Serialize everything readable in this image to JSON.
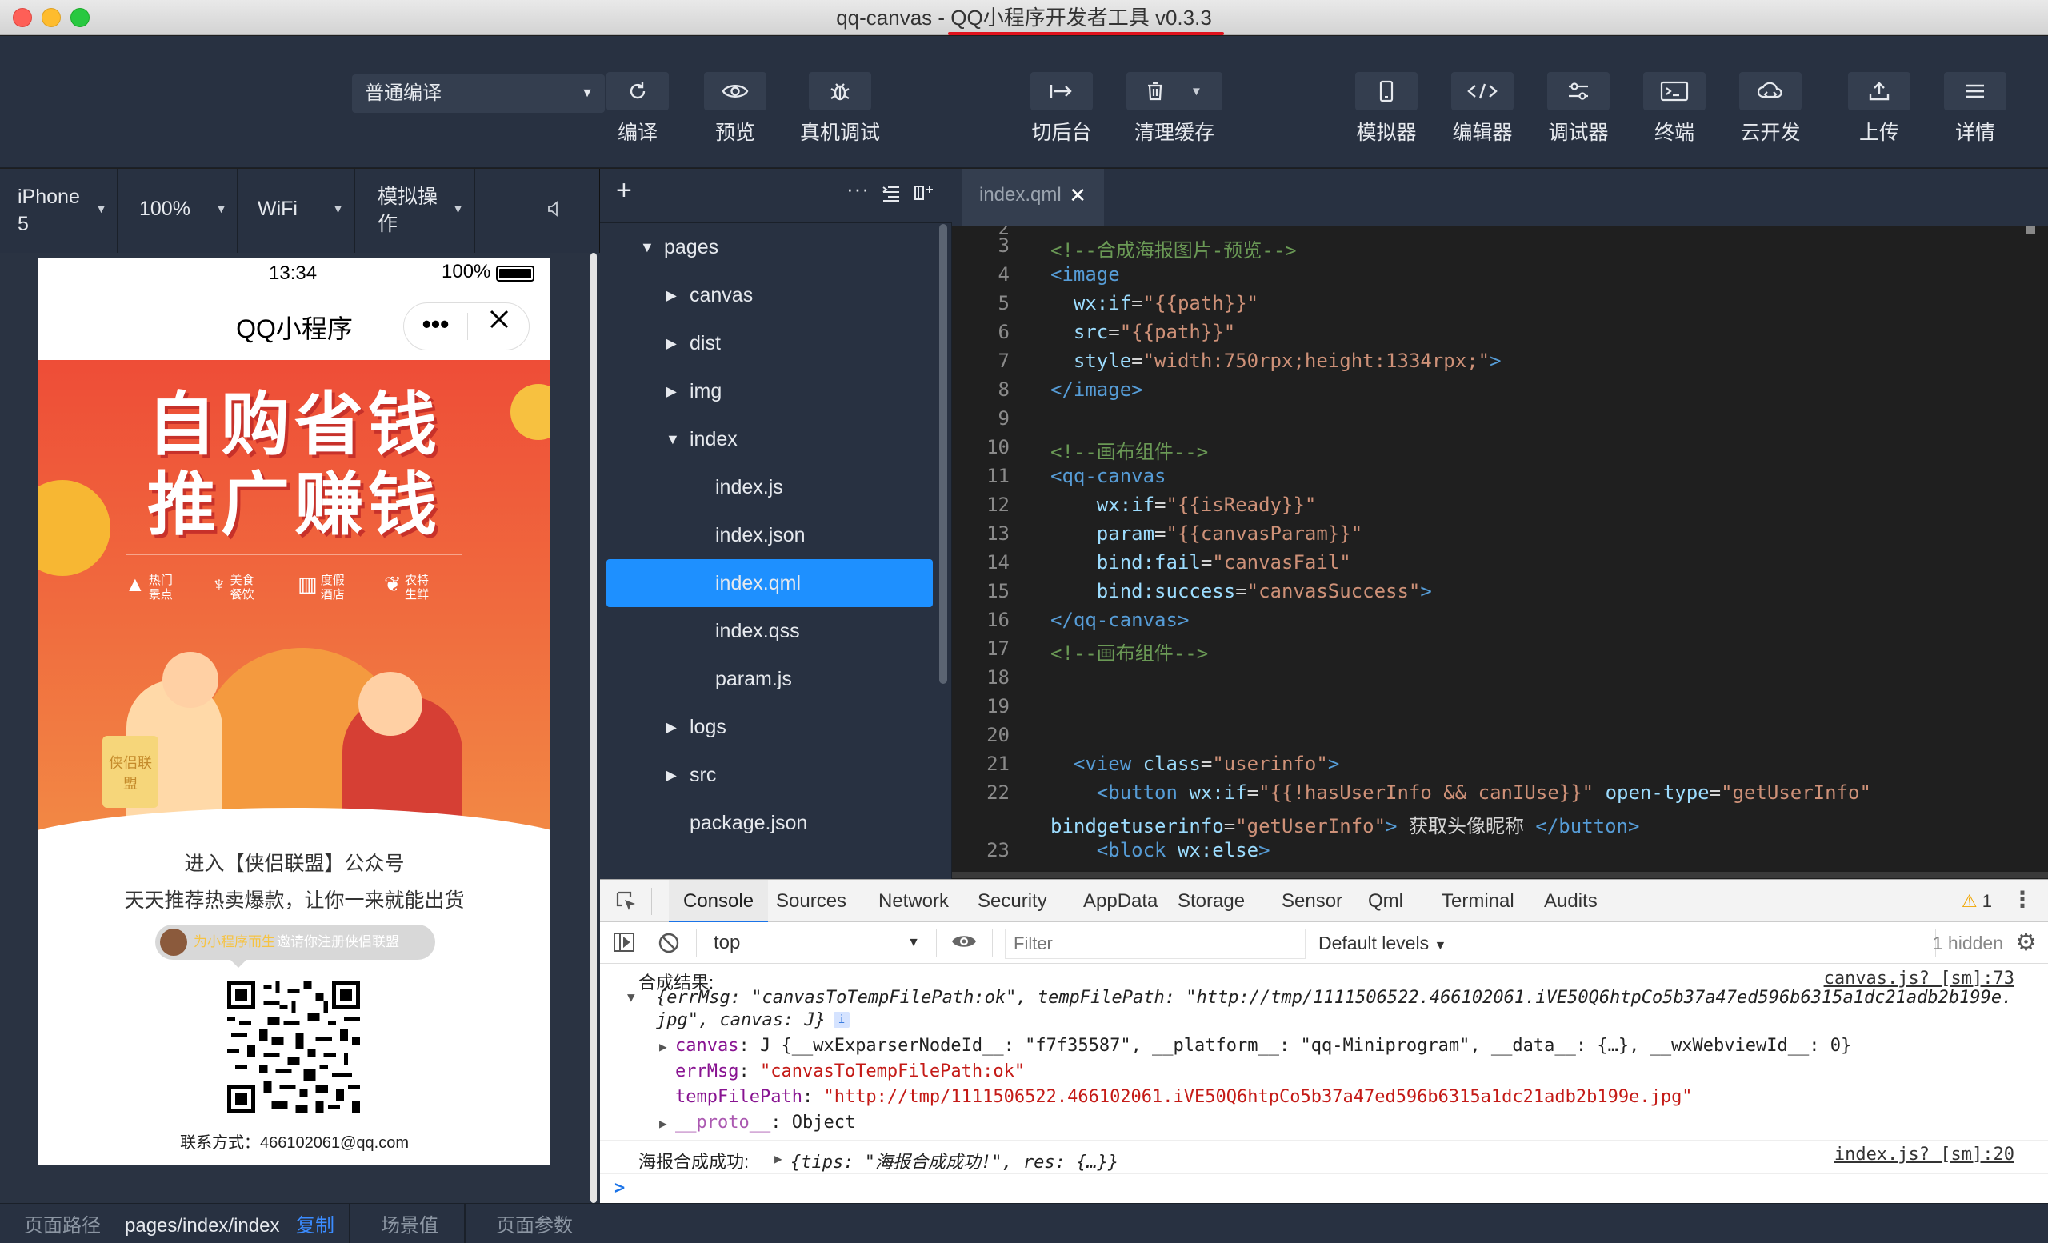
{
  "window": {
    "title_prefix": "qq-canvas - ",
    "title_app": "QQ小程序开发者工具 v0.3.3"
  },
  "toolbar": {
    "compile_mode": "普通编译",
    "left_buttons": [
      "编译",
      "预览",
      "真机调试"
    ],
    "mid_buttons": [
      "切后台",
      "清理缓存"
    ],
    "right_buttons": [
      "模拟器",
      "编辑器",
      "调试器",
      "终端",
      "云开发",
      "上传",
      "详情"
    ],
    "icons": [
      "refresh-icon",
      "eye-icon",
      "bug-icon",
      "switch-background-icon",
      "trash-icon",
      "phone-icon",
      "code-icon",
      "sliders-icon",
      "terminal-icon",
      "cloud-icon",
      "upload-icon",
      "menu-icon"
    ]
  },
  "device_bar": {
    "device": "iPhone 5",
    "zoom": "100%",
    "network": "WiFi",
    "operation": "模拟操作"
  },
  "phone": {
    "time": "13:34",
    "battery": "100%",
    "nav_title": "QQ小程序",
    "poster": {
      "headline_line1": "自购省钱",
      "headline_line2": "推广赚钱",
      "categories": [
        "热门景点",
        "美食餐饮",
        "度假酒店",
        "农特生鲜"
      ],
      "bag_text": "侠侣联盟",
      "line1": "进入【侠侣联盟】公众号",
      "line2": "天天推荐热卖爆款，让你一来就能出货",
      "invite_name": "为小程序而生",
      "invite_text": "邀请你注册侠侣联盟",
      "contact": "联系方式：466102061@qq.com"
    }
  },
  "file_tree": {
    "items": [
      {
        "label": "pages",
        "type": "folder",
        "open": true,
        "depth": 0
      },
      {
        "label": "canvas",
        "type": "folder",
        "open": false,
        "depth": 1
      },
      {
        "label": "dist",
        "type": "folder",
        "open": false,
        "depth": 1
      },
      {
        "label": "img",
        "type": "folder",
        "open": false,
        "depth": 1
      },
      {
        "label": "index",
        "type": "folder",
        "open": true,
        "depth": 1
      },
      {
        "label": "index.js",
        "type": "file",
        "depth": 2
      },
      {
        "label": "index.json",
        "type": "file",
        "depth": 2
      },
      {
        "label": "index.qml",
        "type": "file",
        "depth": 2,
        "selected": true
      },
      {
        "label": "index.qss",
        "type": "file",
        "depth": 2
      },
      {
        "label": "param.js",
        "type": "file",
        "depth": 2
      },
      {
        "label": "logs",
        "type": "folder",
        "open": false,
        "depth": 1
      },
      {
        "label": "src",
        "type": "folder",
        "open": false,
        "depth": 1
      },
      {
        "label": "package.json",
        "type": "file",
        "depth": 1
      }
    ]
  },
  "editor": {
    "tab": "index.qml",
    "partial_top_line": "2",
    "lines": [
      {
        "n": "3",
        "p": [
          [
            "cm",
            "<!--合成海报图片-预览-->"
          ]
        ]
      },
      {
        "n": "4",
        "p": [
          [
            "tg",
            "<image"
          ]
        ]
      },
      {
        "n": "5",
        "p": [
          [
            "pl",
            "  "
          ],
          [
            "at",
            "wx:if"
          ],
          [
            "pl",
            "="
          ],
          [
            "sv",
            "\"{{path}}\""
          ]
        ]
      },
      {
        "n": "6",
        "p": [
          [
            "pl",
            "  "
          ],
          [
            "at",
            "src"
          ],
          [
            "pl",
            "="
          ],
          [
            "sv",
            "\"{{path}}\""
          ]
        ]
      },
      {
        "n": "7",
        "p": [
          [
            "pl",
            "  "
          ],
          [
            "at",
            "style"
          ],
          [
            "pl",
            "="
          ],
          [
            "sv",
            "\"width:750rpx;height:1334rpx;\""
          ],
          [
            "tg",
            ">"
          ]
        ]
      },
      {
        "n": "8",
        "p": [
          [
            "tg",
            "</image>"
          ]
        ]
      },
      {
        "n": "9",
        "p": []
      },
      {
        "n": "10",
        "p": [
          [
            "cm",
            "<!--画布组件-->"
          ]
        ]
      },
      {
        "n": "11",
        "p": [
          [
            "tg",
            "<qq-canvas"
          ]
        ]
      },
      {
        "n": "12",
        "p": [
          [
            "pl",
            "    "
          ],
          [
            "at",
            "wx:if"
          ],
          [
            "pl",
            "="
          ],
          [
            "sv",
            "\"{{isReady}}\""
          ]
        ]
      },
      {
        "n": "13",
        "p": [
          [
            "pl",
            "    "
          ],
          [
            "at",
            "param"
          ],
          [
            "pl",
            "="
          ],
          [
            "sv",
            "\"{{canvasParam}}\""
          ]
        ]
      },
      {
        "n": "14",
        "p": [
          [
            "pl",
            "    "
          ],
          [
            "at",
            "bind:fail"
          ],
          [
            "pl",
            "="
          ],
          [
            "sv",
            "\"canvasFail\""
          ]
        ]
      },
      {
        "n": "15",
        "p": [
          [
            "pl",
            "    "
          ],
          [
            "at",
            "bind:success"
          ],
          [
            "pl",
            "="
          ],
          [
            "sv",
            "\"canvasSuccess\""
          ],
          [
            "tg",
            ">"
          ]
        ]
      },
      {
        "n": "16",
        "p": [
          [
            "tg",
            "</qq-canvas>"
          ]
        ]
      },
      {
        "n": "17",
        "p": [
          [
            "cm",
            "<!--画布组件-->"
          ]
        ]
      },
      {
        "n": "18",
        "p": []
      },
      {
        "n": "19",
        "p": []
      },
      {
        "n": "20",
        "p": []
      },
      {
        "n": "21",
        "p": [
          [
            "pl",
            "  "
          ],
          [
            "tg",
            "<view "
          ],
          [
            "at",
            "class"
          ],
          [
            "pl",
            "="
          ],
          [
            "sv",
            "\"userinfo\""
          ],
          [
            "tg",
            ">"
          ]
        ]
      },
      {
        "n": "22",
        "p": [
          [
            "pl",
            "    "
          ],
          [
            "tg",
            "<button "
          ],
          [
            "at",
            "wx:if"
          ],
          [
            "pl",
            "="
          ],
          [
            "sv",
            "\"{{!hasUserInfo && canIUse}}\""
          ],
          [
            "pl",
            " "
          ],
          [
            "at",
            "open-type"
          ],
          [
            "pl",
            "="
          ],
          [
            "sv",
            "\"getUserInfo\""
          ]
        ]
      },
      {
        "n": "",
        "p": [
          [
            "at",
            "bindgetuserinfo"
          ],
          [
            "pl",
            "="
          ],
          [
            "sv",
            "\"getUserInfo\""
          ],
          [
            "tg",
            ">"
          ],
          [
            "pl",
            " 获取头像昵称 "
          ],
          [
            "tg",
            "</button>"
          ]
        ]
      },
      {
        "n": "23",
        "p": [
          [
            "pl",
            "    "
          ],
          [
            "tg",
            "<block "
          ],
          [
            "at",
            "wx:else"
          ],
          [
            "tg",
            ">"
          ]
        ]
      }
    ]
  },
  "devtools": {
    "tabs": [
      "Console",
      "Sources",
      "Network",
      "Security",
      "AppData",
      "Storage",
      "Sensor",
      "Qml",
      "Terminal",
      "Audits"
    ],
    "active_tab": "Console",
    "warning_count": "1",
    "context": "top",
    "filter_placeholder": "Filter",
    "levels": "Default levels",
    "hidden": "1 hidden",
    "log1": {
      "label": "合成结果:",
      "source": "canvas.js? [sm]:73",
      "obj_line1": "{errMsg: \"canvasToTempFilePath:ok\", tempFilePath: \"http://tmp/1111506522.466102061.iVE50Q6htpCo5b37a47ed596b6315a1dc21adb2b199e.",
      "obj_line2": "jpg\", canvas: J}",
      "canvas_key": "canvas",
      "canvas_val": "J {__wxExparserNodeId__: \"f7f35587\", __platform__: \"qq-Miniprogram\", __data__: {…}, __wxWebviewId__: 0}",
      "errMsg_key": "errMsg",
      "errMsg_val": "\"canvasToTempFilePath:ok\"",
      "path_key": "tempFilePath",
      "path_val": "\"http://tmp/1111506522.466102061.iVE50Q6htpCo5b37a47ed596b6315a1dc21adb2b199e.jpg\"",
      "proto_key": "__proto__",
      "proto_val": "Object"
    },
    "log2": {
      "label": "海报合成成功:",
      "obj": "{tips: \"海报合成成功!\", res: {…}}",
      "source": "index.js? [sm]:20"
    },
    "prompt": ">"
  },
  "bottom_bar": {
    "path_label": "页面路径",
    "path": "pages/index/index",
    "copy": "复制",
    "scene": "场景值",
    "params": "页面参数"
  },
  "colors": {
    "toolbar_bg": "#283141",
    "selection": "#1e90ff",
    "accent_red": "#e0121d",
    "poster_red": "#ef5a3c"
  }
}
